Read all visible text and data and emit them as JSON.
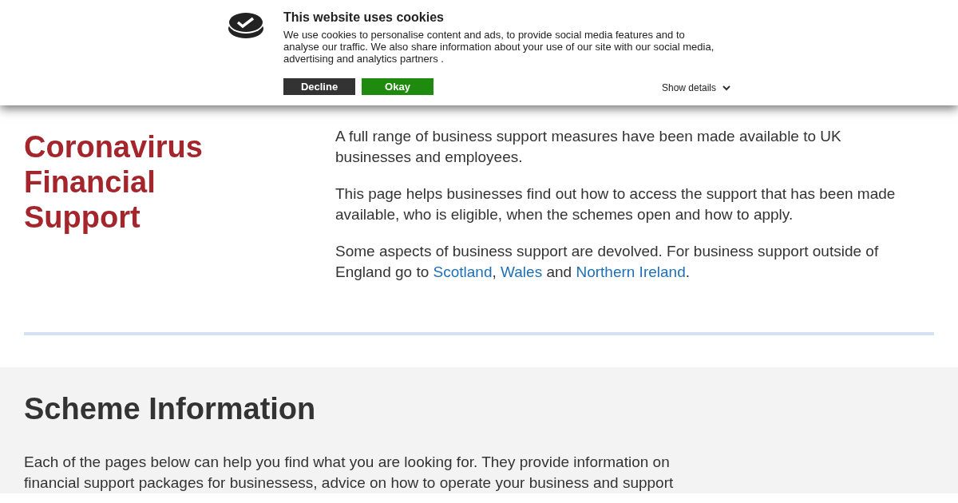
{
  "cookie_banner": {
    "title": "This website uses cookies",
    "text": "We use cookies to personalise content and ads, to provide social media features and to analyse our traffic. We also share information about your use of our site with our social media, advertising and analytics partners .",
    "buttons": [
      {
        "label": "Decline",
        "kind": "decline"
      },
      {
        "label": "Okay",
        "kind": "accept"
      }
    ],
    "details_link": "Show details"
  },
  "intro": {
    "title": "Coronavirus Financial Support",
    "paragraphs": [
      [
        {
          "text": "A full range of business support measures have been made available to UK businesses and employees."
        }
      ],
      [
        {
          "text": "This page helps businesses find out how to access the support that has been made available, who is eligible, when the schemes open and how to apply."
        }
      ],
      [
        {
          "text": "Some aspects of business support are devolved. For business support outside of England go to "
        },
        {
          "text": "Scotland",
          "link": true
        },
        {
          "text": ", "
        },
        {
          "text": "Wales",
          "link": true
        },
        {
          "text": " and "
        },
        {
          "text": "Northern Ireland",
          "link": true
        },
        {
          "text": "."
        }
      ]
    ]
  },
  "scheme": {
    "heading": "Scheme Information",
    "text": "Each of the pages below can help you find what you are looking for. They provide information on financial support packages for businessess, advice on how to operate your business and support"
  }
}
